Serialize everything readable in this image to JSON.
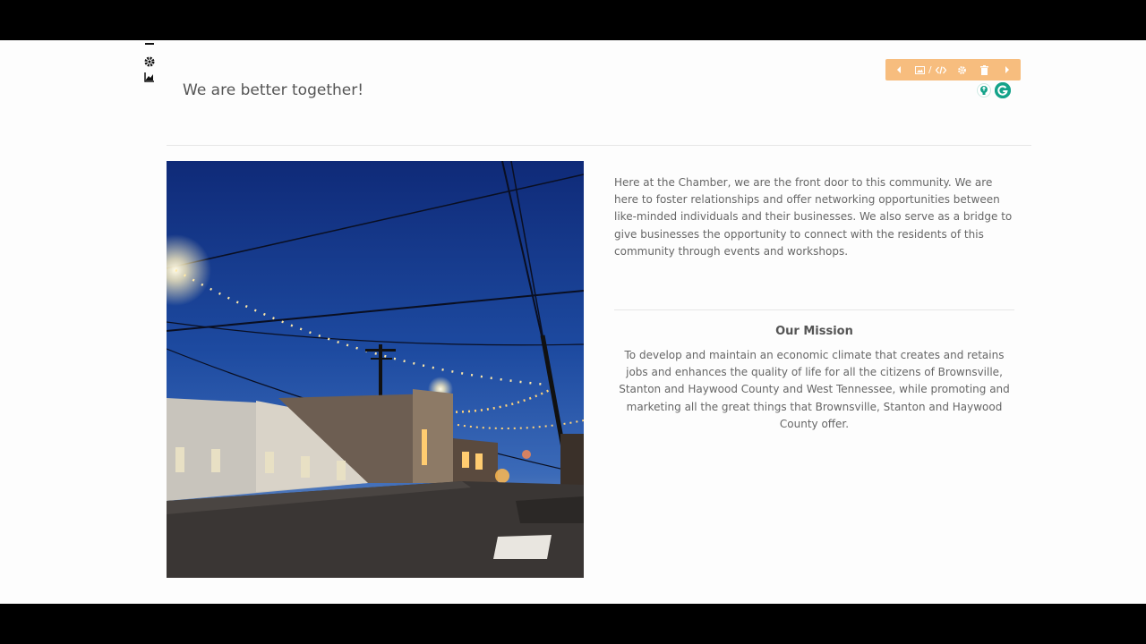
{
  "page": {
    "title": "We are better together!",
    "intro": "Here at the Chamber, we are the front door to this community. We are here to foster relationships and offer networking opportunities between like-minded individuals and their businesses. We also serve as a bridge to give businesses the opportunity to connect with the residents of this community through events and workshops.",
    "mission_title": "Our Mission",
    "mission_text": "To develop and maintain an economic climate that creates and retains jobs and enhances the quality of life for all the citizens of Brownsville, Stanton and Haywood County and West Tennessee, while promoting and marketing all the great things that Brownsville, Stanton and Haywood County offer."
  },
  "toolbar": {
    "media_separator": "/",
    "icons": [
      "arrow-left-icon",
      "image-icon",
      "code-icon",
      "gear-icon",
      "trash-icon",
      "arrow-right-icon"
    ]
  },
  "side_tools": [
    "minus-icon",
    "gear-icon",
    "chart-icon"
  ],
  "colors": {
    "toolbar_bg": "#f7bd7e",
    "page_bg": "#fdfdfd",
    "text": "#666666",
    "heading": "#555555",
    "grammarly": "#15a38a"
  }
}
